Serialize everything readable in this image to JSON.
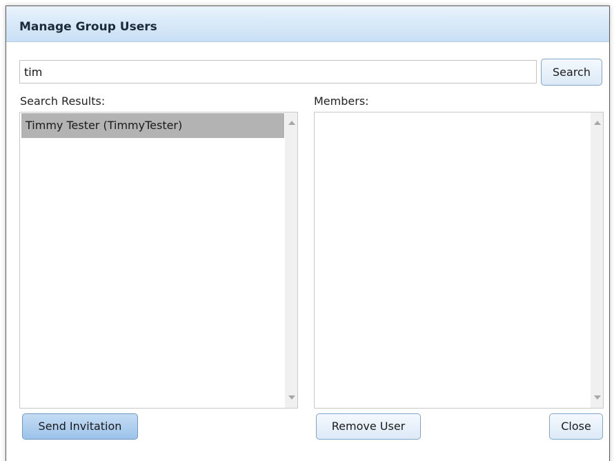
{
  "dialog": {
    "title": "Manage Group Users"
  },
  "search": {
    "value": "tim",
    "button_label": "Search"
  },
  "results": {
    "label": "Search Results:",
    "items": [
      {
        "text": "Timmy Tester (TimmyTester)",
        "selected": true
      }
    ]
  },
  "members": {
    "label": "Members:",
    "items": []
  },
  "actions": {
    "send_invitation": "Send Invitation",
    "remove_user": "Remove User",
    "close": "Close"
  },
  "colors": {
    "titlebar": "#d6e8f8",
    "selected_item": "#b3b3b3",
    "primary_button": "#9cc3ea"
  },
  "icons": {
    "scroll_up": "scroll-up-arrow-icon",
    "scroll_down": "scroll-down-arrow-icon"
  }
}
